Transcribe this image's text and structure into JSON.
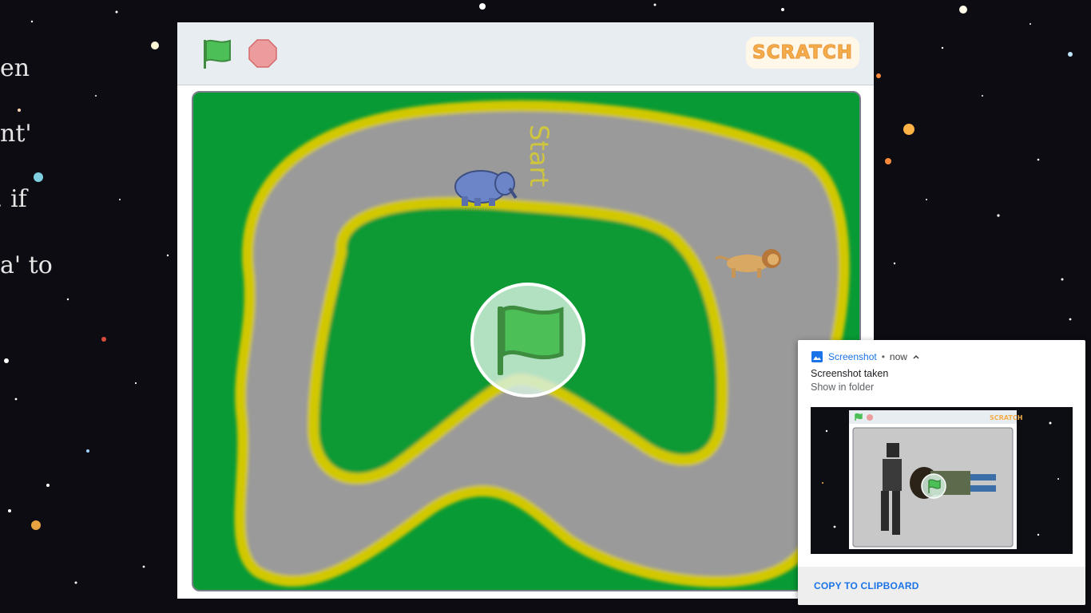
{
  "background": {
    "side_text": [
      "en",
      "nt'",
      ". if",
      "a' to"
    ]
  },
  "player": {
    "green_flag": {
      "icon": "green-flag-icon",
      "color": "#4cbf56"
    },
    "stop": {
      "icon": "stop-icon",
      "color": "#ec9c9c"
    },
    "logo": "SCRATCH",
    "stage": {
      "track_text": "Start",
      "colors": {
        "grass": "#079a35",
        "track": "#9a9a9a",
        "border": "#d2c800"
      },
      "sprites": [
        "elephant-sprite",
        "lion-sprite"
      ],
      "start_overlay_icon": "green-flag-icon"
    }
  },
  "notification": {
    "app_name": "Screenshot",
    "separator": "•",
    "time": "now",
    "title": "Screenshot taken",
    "subtitle": "Show in folder",
    "thumbnail": {
      "logo": "SCRATCH",
      "sprites": [
        "robot-sprite",
        "person-sprite"
      ]
    },
    "action": "COPY TO CLIPBOARD",
    "accent": "#1a73e8"
  }
}
